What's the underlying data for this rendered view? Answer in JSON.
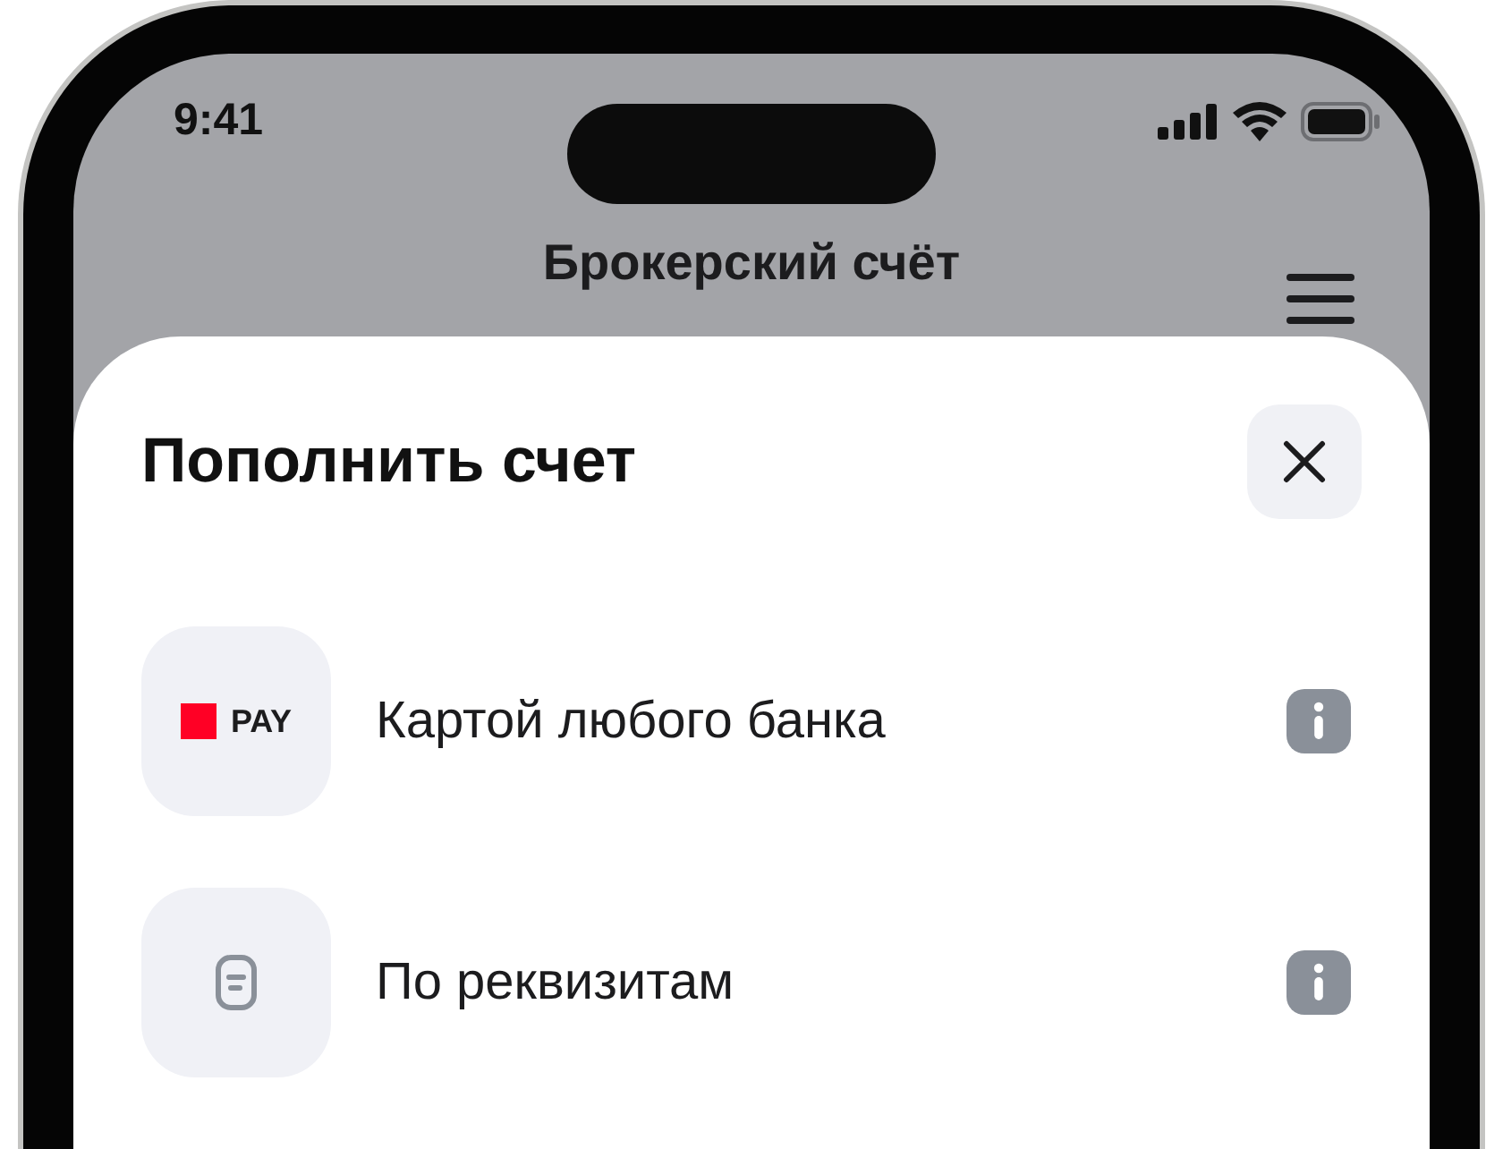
{
  "status_bar": {
    "time": "9:41"
  },
  "header": {
    "title": "Брокерский счёт"
  },
  "sheet": {
    "title": "Пополнить счет",
    "methods": [
      {
        "kind": "pay",
        "logo_text": "PAY",
        "label": "Картой любого банка"
      },
      {
        "kind": "details",
        "label": "По реквизитам"
      }
    ]
  }
}
